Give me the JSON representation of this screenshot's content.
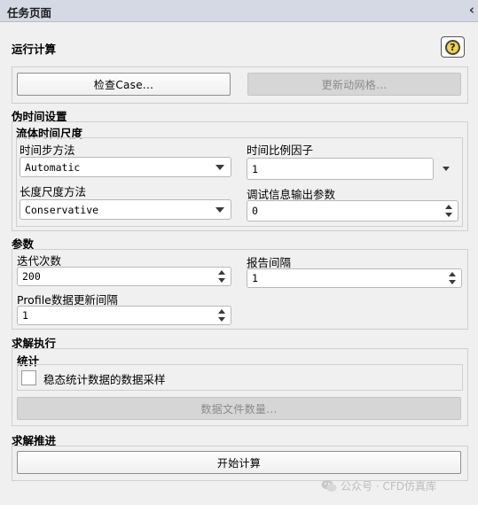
{
  "panel": {
    "title": "任务页面",
    "collapse_icon": "chevron-left-icon"
  },
  "run": {
    "heading": "运行计算",
    "help_icon": "help-icon",
    "help_glyph": "?",
    "check_case_button": "检查Case...",
    "update_mesh_button": "更新动网格..."
  },
  "pseudo_time": {
    "heading": "伪时间设置",
    "fluid_scale_heading": "流体时间尺度",
    "time_step_method_label": "时间步方法",
    "time_step_method_value": "Automatic",
    "time_scale_factor_label": "时间比例因子",
    "time_scale_factor_value": "1",
    "length_scale_method_label": "长度尺度方法",
    "length_scale_method_value": "Conservative",
    "verbosity_label": "调试信息输出参数",
    "verbosity_value": "0"
  },
  "parameters": {
    "heading": "参数",
    "iterations_label": "迭代次数",
    "iterations_value": "200",
    "report_interval_label": "报告间隔",
    "report_interval_value": "1",
    "profile_update_label": "Profile数据更新间隔",
    "profile_update_value": "1"
  },
  "solution_execution": {
    "heading": "求解执行",
    "statistics_heading": "统计",
    "sampling_checkbox_label": "稳态统计数据的数据采样",
    "sampling_checked": false,
    "data_file_quantities_button": "数据文件数量..."
  },
  "solution_advancement": {
    "heading": "求解推进",
    "calculate_button": "开始计算"
  },
  "watermark": {
    "text": "公众号 · CFD仿真库",
    "icon": "wechat-icon"
  }
}
